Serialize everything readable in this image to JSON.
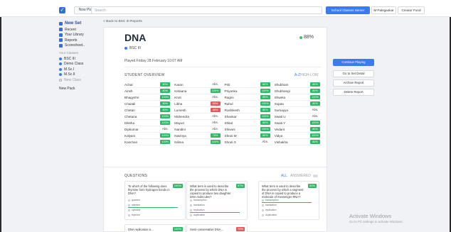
{
  "topbar": {
    "logo_icon": "check-icon",
    "now_playing_label": "Now Playing",
    "search_placeholder": "Search",
    "server_button_label": "School Classes Server",
    "user_button_label": "M Palegaokar",
    "fund_button_label": "Creator Fund"
  },
  "sidebar": {
    "new_set_label": "New Set",
    "items": [
      {
        "label": "Recent",
        "icon": "clock-icon"
      },
      {
        "label": "Your Library",
        "icon": "library-icon"
      },
      {
        "label": "Reports",
        "icon": "reports-icon"
      },
      {
        "label": "Scoresheet..",
        "icon": "scoresheet-icon"
      }
    ],
    "classes_heading": "Your Classes",
    "classes": [
      {
        "label": "BSC III"
      },
      {
        "label": "Demo Class"
      },
      {
        "label": "M.Sc.I"
      },
      {
        "label": "M.Sc.II"
      }
    ],
    "new_class_label": "New Class",
    "new_pack_label": "New Pack"
  },
  "breadcrumb": "< Back to BSC III Reports",
  "report": {
    "title": "DNA",
    "class_name": "BSC III",
    "score": "88%",
    "played": "Played Friday 28 February 10:07 AM",
    "overview_label": "STUDENT OVERVIEW",
    "sort_az": "A-Z",
    "sort_high_low": "HIGH-LOW",
    "students": [
      {
        "name": "Achal",
        "result": "80%",
        "status": "green"
      },
      {
        "name": "Karan",
        "result": "Abs.",
        "status": "abs"
      },
      {
        "name": "Priti",
        "result": "80%",
        "status": "green"
      },
      {
        "name": "Shubham",
        "result": "80%",
        "status": "green"
      },
      {
        "name": "Ainsh",
        "result": "80%",
        "status": "green"
      },
      {
        "name": "Ketaana",
        "result": "100%",
        "status": "green"
      },
      {
        "name": "Priyanka",
        "result": "100%",
        "status": "green"
      },
      {
        "name": "Shubhangi",
        "result": "80%",
        "status": "green"
      },
      {
        "name": "Bhagyshri",
        "result": "100%",
        "status": "green"
      },
      {
        "name": "Kruti",
        "result": "Abs.",
        "status": "abs"
      },
      {
        "name": "Ragini",
        "result": "80%",
        "status": "green"
      },
      {
        "name": "Shweta",
        "result": "100%",
        "status": "green"
      },
      {
        "name": "Chaitali",
        "result": "80%",
        "status": "green"
      },
      {
        "name": "Likha",
        "result": "60%",
        "status": "red"
      },
      {
        "name": "Rahul",
        "result": "100%",
        "status": "green"
      },
      {
        "name": "Sujata",
        "result": "80%",
        "status": "green"
      },
      {
        "name": "Chetan",
        "result": "80%",
        "status": "green"
      },
      {
        "name": "Lumesh",
        "result": "40%",
        "status": "red"
      },
      {
        "name": "Rushikesh",
        "result": "80%",
        "status": "green"
      },
      {
        "name": "Sumayya",
        "result": "Abs.",
        "status": "abs"
      },
      {
        "name": "Chetana",
        "result": "100%",
        "status": "green"
      },
      {
        "name": "Mahendra",
        "result": "Abs.",
        "status": "abs"
      },
      {
        "name": "Shankar",
        "result": "100%",
        "status": "green"
      },
      {
        "name": "Swati U",
        "result": "Abs.",
        "status": "abs"
      },
      {
        "name": "Diksha",
        "result": "100%",
        "status": "green"
      },
      {
        "name": "Mayuri",
        "result": "Abs.",
        "status": "abs"
      },
      {
        "name": "Shital",
        "result": "80%",
        "status": "green"
      },
      {
        "name": "Swati Y",
        "result": "100%",
        "status": "green"
      },
      {
        "name": "Dipkumar",
        "result": "Abs.",
        "status": "abs"
      },
      {
        "name": "Nandini",
        "result": "Abs.",
        "status": "abs"
      },
      {
        "name": "Shivani",
        "result": "100%",
        "status": "green"
      },
      {
        "name": "Vedant",
        "result": "80%",
        "status": "green"
      },
      {
        "name": "Kalyani",
        "result": "100%",
        "status": "green"
      },
      {
        "name": "Navinya",
        "result": "75%",
        "status": "green"
      },
      {
        "name": "Shruti M",
        "result": "80%",
        "status": "green"
      },
      {
        "name": "Vidya",
        "result": "100%",
        "status": "green"
      },
      {
        "name": "Kanchan",
        "result": "100%",
        "status": "green"
      },
      {
        "name": "Nilima",
        "result": "100%",
        "status": "green"
      },
      {
        "name": "Shruti S",
        "result": "Abs.",
        "status": "abs"
      },
      {
        "name": "Vishakha",
        "result": "80%",
        "status": "green"
      }
    ],
    "questions_label": "QUESTIONS",
    "q_all": "ALL",
    "q_answered": "ANSWERED",
    "questions": [
      {
        "text": "To which of the following does thymine form hydrogen bonds in DNA?",
        "score": "100%",
        "options": [
          "guanine",
          "adenine",
          "cytosine",
          "thymine"
        ],
        "correct_index": 1
      },
      {
        "text": "What term is used to describe the process by which DNA is copied to produce two daughter DNA molecules?",
        "score": "97%",
        "options": [
          "transcription",
          "translation",
          "replication",
          "duplication"
        ],
        "correct_index": 2
      },
      {
        "text": "What term is used to describe the process by which a segment of DNA is copied to produce a molecule of messenger RNA?",
        "score": "90%",
        "options": [
          "transcription",
          "translation",
          "replication",
          "duplication"
        ],
        "correct_index": 0
      }
    ],
    "questions_row2": [
      {
        "text": "DNA replication is...",
        "score": "100%",
        "color": "green"
      },
      {
        "text": "Semi-conservative DNA...",
        "score": "75%",
        "color": "red"
      }
    ]
  },
  "actions": {
    "continue": "Continue Playing",
    "go_detail": "Go to Set Detail",
    "archive": "Archive Report",
    "delete": "Delete Report"
  },
  "watermark": {
    "line1": "Activate Windows",
    "line2": "Go to PC settings to activate Windows."
  },
  "colors": {
    "accent": "#3a7bef",
    "correct": "#2fb865",
    "incorrect": "#e25b5b"
  }
}
